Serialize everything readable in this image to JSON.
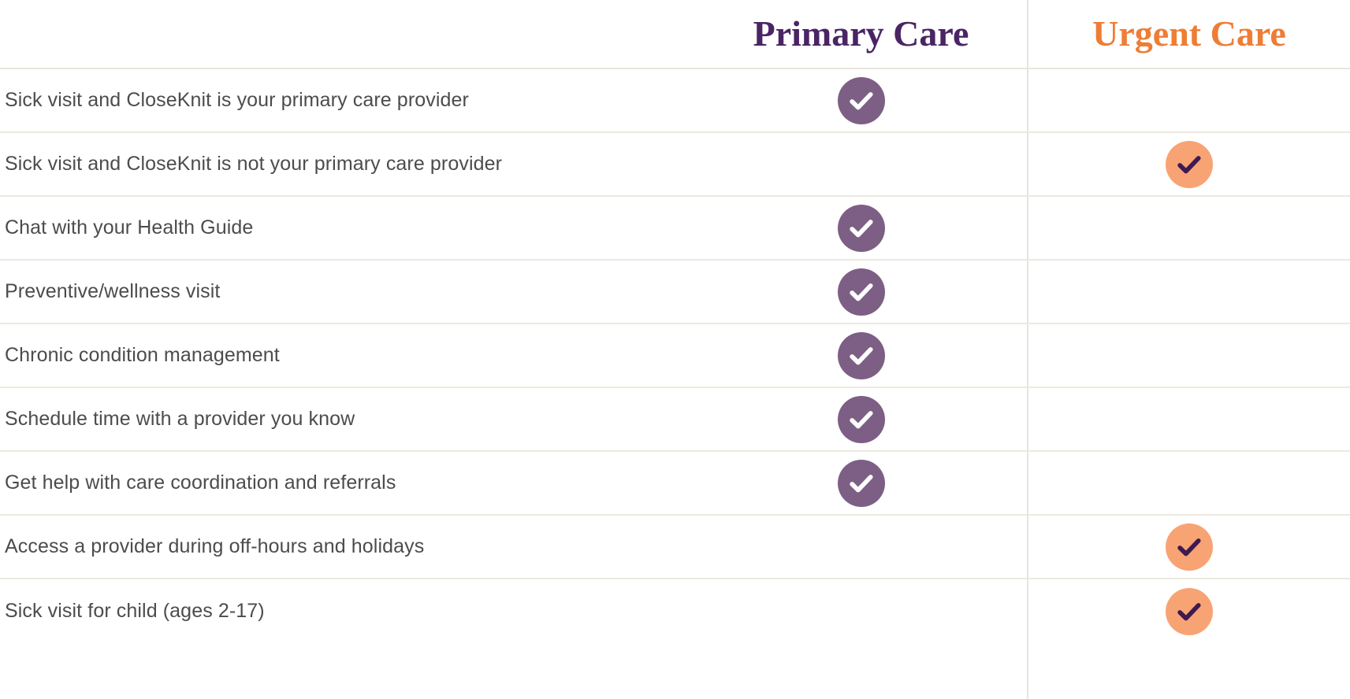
{
  "table": {
    "columns": [
      {
        "key": "feature",
        "label": ""
      },
      {
        "key": "primary",
        "label": "Primary Care",
        "color": "#4a2464"
      },
      {
        "key": "urgent",
        "label": "Urgent Care",
        "color": "#ee7d35"
      }
    ],
    "header": {
      "feature_label": "",
      "primary_label": "Primary Care",
      "urgent_label": "Urgent Care"
    },
    "rows": [
      {
        "feature": "Sick visit and CloseKnit is your primary care provider",
        "primary": true,
        "urgent": false
      },
      {
        "feature": "Sick visit and CloseKnit is not your primary care provider",
        "primary": false,
        "urgent": true
      },
      {
        "feature": "Chat with your Health Guide",
        "primary": true,
        "urgent": false
      },
      {
        "feature": "Preventive/wellness visit",
        "primary": true,
        "urgent": false
      },
      {
        "feature": "Chronic condition management",
        "primary": true,
        "urgent": false
      },
      {
        "feature": "Schedule time with a provider you know",
        "primary": true,
        "urgent": false
      },
      {
        "feature": "Get help with care coordination and referrals",
        "primary": true,
        "urgent": false
      },
      {
        "feature": "Access a provider during off-hours and holidays",
        "primary": false,
        "urgent": true
      },
      {
        "feature": "Sick visit for child (ages 2-17)",
        "primary": false,
        "urgent": true
      }
    ]
  },
  "icons": {
    "primary_check": "check-circle-purple-icon",
    "urgent_check": "check-circle-orange-icon"
  },
  "colors": {
    "primary_header_text": "#4a2464",
    "urgent_header_text": "#ee7d35",
    "primary_badge_fill": "#7d5f85",
    "primary_badge_check": "#ffffff",
    "urgent_badge_fill": "#f8a374",
    "urgent_badge_check": "#3d1a52",
    "row_text": "#4c4c4c",
    "divider": "#eceade",
    "background": "#ffffff"
  }
}
